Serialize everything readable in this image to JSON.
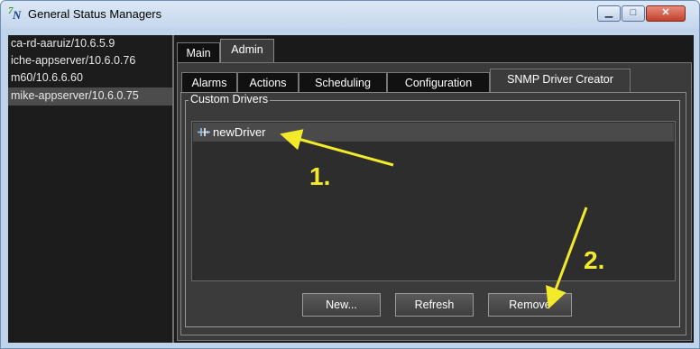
{
  "window": {
    "title": "General Status Managers",
    "app_icon": "tn-app-icon",
    "min_glyph": "▁",
    "max_glyph": "□",
    "close_glyph": "✕"
  },
  "servers": [
    "ca-rd-aaruiz/10.6.5.9",
    "iche-appserver/10.6.0.76",
    "m60/10.6.6.60",
    "mike-appserver/10.6.0.75"
  ],
  "selected_server_index": 3,
  "top_tabs": [
    "Main",
    "Admin"
  ],
  "selected_top_tab": "Admin",
  "admin_tabs": [
    "Alarms",
    "Actions",
    "Scheduling",
    "Configuration",
    "SNMP Driver Creator"
  ],
  "selected_admin_tab": "SNMP Driver Creator",
  "custom_drivers": {
    "group_label": "Custom Drivers",
    "items": [
      "newDriver"
    ],
    "selected_item": "newDriver"
  },
  "buttons": {
    "new": "New...",
    "refresh": "Refresh",
    "remove": "Remove"
  },
  "annotations": {
    "step1": "1.",
    "step2": "2.",
    "arrow_color": "#f2ea2a"
  }
}
